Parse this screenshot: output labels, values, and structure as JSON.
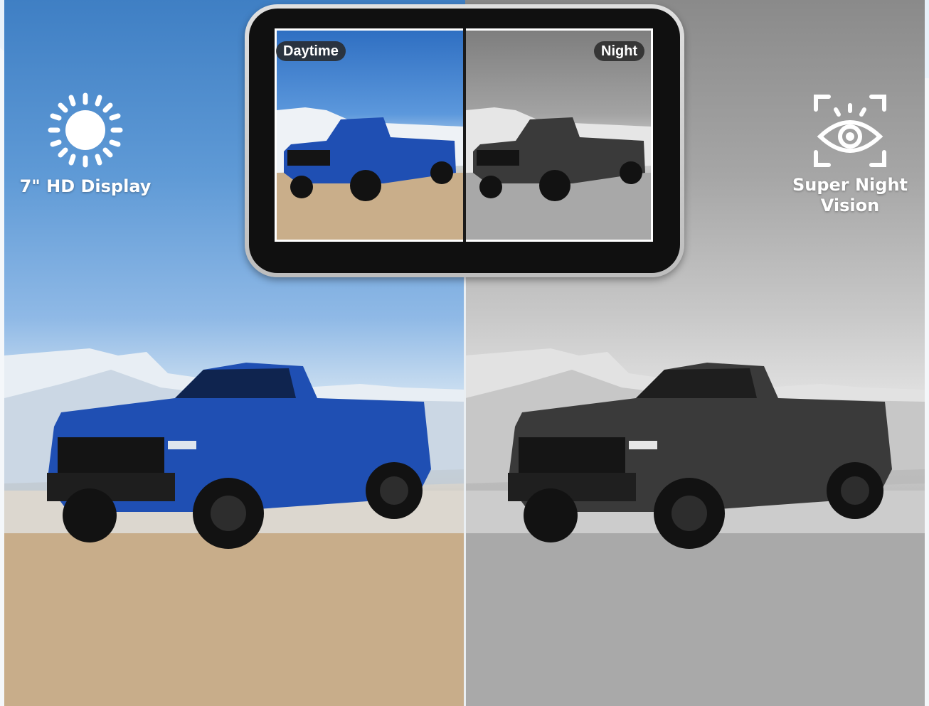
{
  "features": {
    "left": {
      "icon": "sun-icon",
      "label": "7\" HD Display"
    },
    "right": {
      "icon": "eye-scan-icon",
      "label_line1": "Super Night",
      "label_line2": "Vision"
    }
  },
  "monitor": {
    "day_label": "Daytime",
    "night_label": "Night"
  },
  "colors": {
    "truck_day": "#1f4fb3",
    "truck_night": "#3a3a3a",
    "sky_day": "#5c98dc",
    "badge_bg": "#282828"
  }
}
